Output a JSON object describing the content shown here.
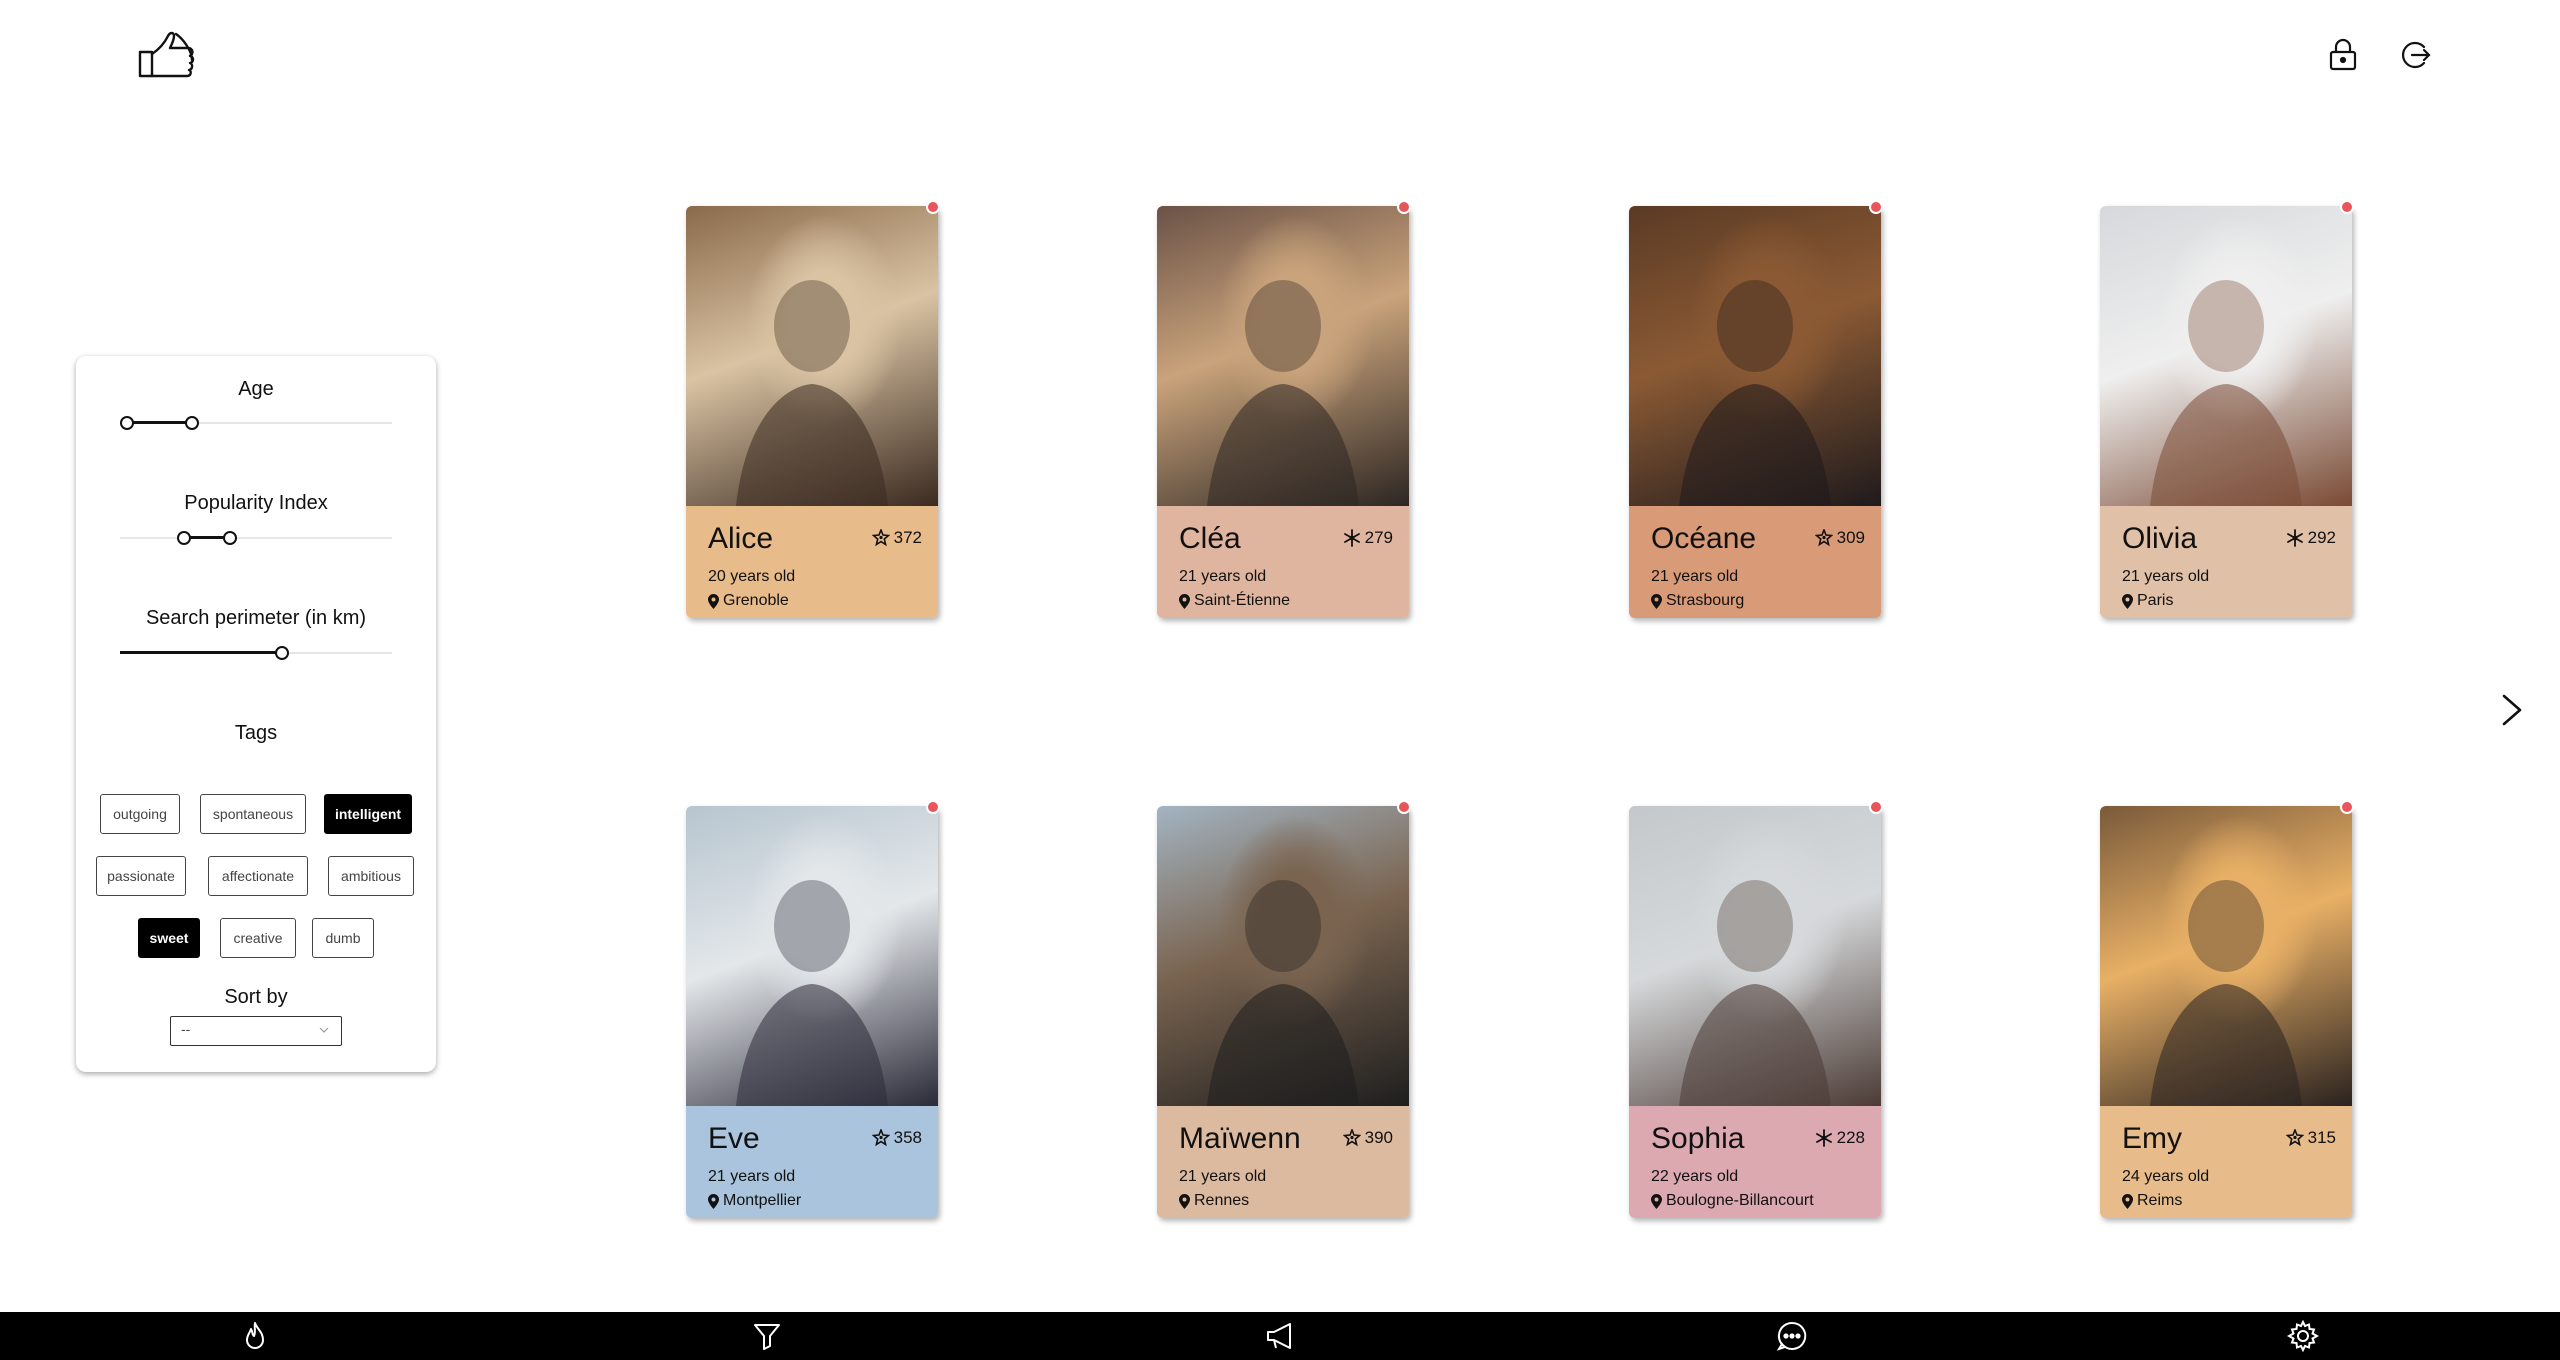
{
  "topbar": {
    "logo_icon": "thumbs-up-hand-icon",
    "lock_icon": "lock-icon",
    "logout_icon": "logout-icon"
  },
  "filters": {
    "age": {
      "label": "Age",
      "min": 0.0,
      "low": 0.0,
      "high": 0.25
    },
    "popularity": {
      "label": "Popularity Index",
      "low": 0.22,
      "high": 0.4
    },
    "perimeter": {
      "label": "Search perimeter (in km)",
      "value": 0.6
    },
    "tags_label": "Tags",
    "tags": [
      {
        "label": "outgoing",
        "active": false
      },
      {
        "label": "spontaneous",
        "active": false
      },
      {
        "label": "intelligent",
        "active": true
      },
      {
        "label": "passionate",
        "active": false
      },
      {
        "label": "affectionate",
        "active": false
      },
      {
        "label": "ambitious",
        "active": false
      },
      {
        "label": "sweet",
        "active": true
      },
      {
        "label": "creative",
        "active": false
      },
      {
        "label": "dumb",
        "active": false
      }
    ],
    "sort_label": "Sort by",
    "sort_value": "--"
  },
  "profiles": [
    {
      "name": "Alice",
      "score": "372",
      "score_icon": "star-person-icon",
      "age": "20 years old",
      "city": "Grenoble",
      "color": "#e8bb8a",
      "photo": [
        "#8a6a4a",
        "#d9c3a3",
        "#3b2a20"
      ]
    },
    {
      "name": "Cléa",
      "score": "279",
      "score_icon": "snowflake-icon",
      "age": "21 years old",
      "city": "Saint-Étienne",
      "color": "#dfb59f",
      "photo": [
        "#6b5247",
        "#c9a37b",
        "#2d2623"
      ]
    },
    {
      "name": "Océane",
      "score": "309",
      "score_icon": "star-person-icon",
      "age": "21 years old",
      "city": "Strasbourg",
      "color": "#d99a78",
      "photo": [
        "#5a3a24",
        "#8b5a34",
        "#1f1a1c"
      ]
    },
    {
      "name": "Olivia",
      "score": "292",
      "score_icon": "snowflake-icon",
      "age": "21 years old",
      "city": "Paris",
      "color": "#e0c0a6",
      "photo": [
        "#d6d8db",
        "#efefef",
        "#7a4a34"
      ]
    },
    {
      "name": "Eve",
      "score": "358",
      "score_icon": "star-person-icon",
      "age": "21 years old",
      "city": "Montpellier",
      "color": "#a9c4dc",
      "photo": [
        "#b7c5cf",
        "#e3e7ea",
        "#2b2a38"
      ]
    },
    {
      "name": "Maïwenn",
      "score": "390",
      "score_icon": "star-person-icon",
      "age": "21 years old",
      "city": "Rennes",
      "color": "#dcbaa0",
      "photo": [
        "#a3b4c2",
        "#7a6450",
        "#1e1e1e"
      ]
    },
    {
      "name": "Sophia",
      "score": "228",
      "score_icon": "snowflake-icon",
      "age": "22 years old",
      "city": "Boulogne-Billancourt",
      "color": "#dca9b0",
      "photo": [
        "#c4c8cb",
        "#d6d9db",
        "#4b3b35"
      ]
    },
    {
      "name": "Emy",
      "score": "315",
      "score_icon": "star-person-icon",
      "age": "24 years old",
      "city": "Reims",
      "color": "#e8bb8a",
      "photo": [
        "#7a5a3a",
        "#e8b066",
        "#2a2220"
      ]
    }
  ],
  "bottom_nav": [
    {
      "name": "fire-icon"
    },
    {
      "name": "filter-icon"
    },
    {
      "name": "megaphone-icon"
    },
    {
      "name": "chat-bubble-icon"
    },
    {
      "name": "gear-icon"
    }
  ]
}
